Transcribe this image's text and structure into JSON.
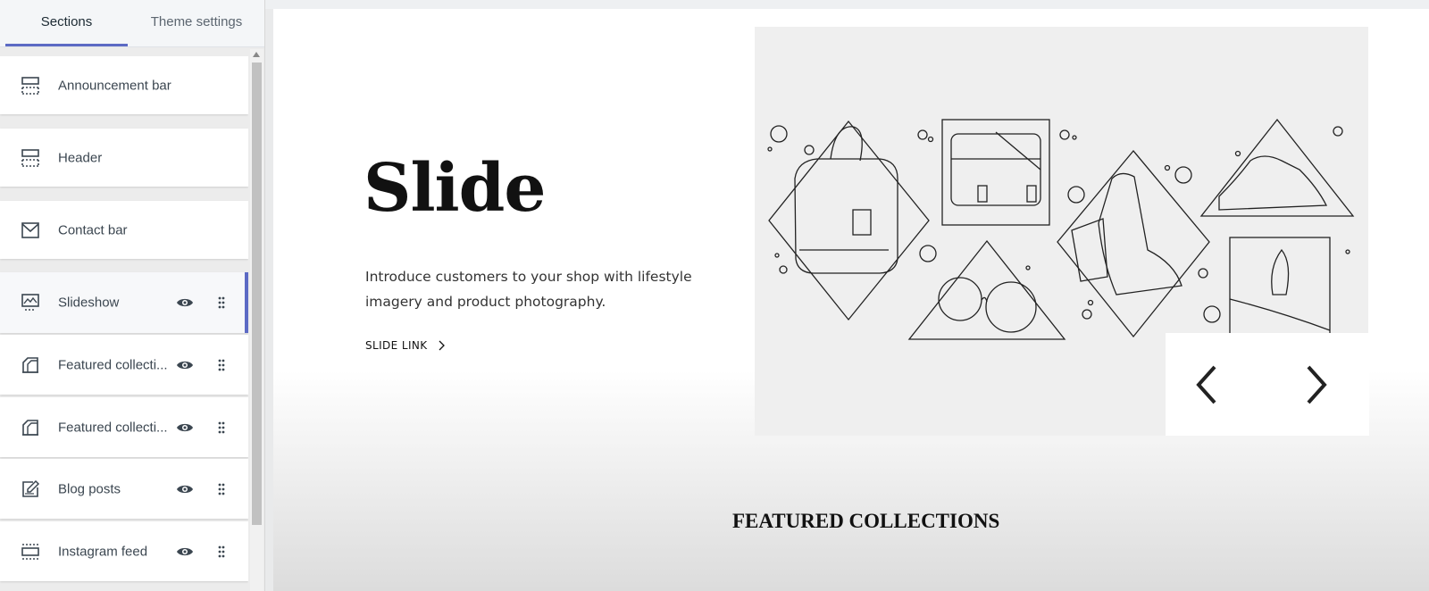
{
  "tabs": [
    {
      "label": "Sections",
      "active": true
    },
    {
      "label": "Theme settings",
      "active": false
    }
  ],
  "sections": [
    {
      "label": "Announcement bar",
      "icon": "layout-header-icon",
      "visibility_toggle": false
    },
    {
      "label": "Header",
      "icon": "layout-header-icon",
      "visibility_toggle": false
    },
    {
      "label": "Contact bar",
      "icon": "envelope-icon",
      "visibility_toggle": false
    },
    {
      "label": "Slideshow",
      "icon": "slideshow-icon",
      "visibility_toggle": true,
      "selected": true
    },
    {
      "label": "Featured collecti...",
      "icon": "collection-icon",
      "visibility_toggle": true
    },
    {
      "label": "Featured collecti...",
      "icon": "collection-icon",
      "visibility_toggle": true
    },
    {
      "label": "Blog posts",
      "icon": "blog-edit-icon",
      "visibility_toggle": true
    },
    {
      "label": "Instagram feed",
      "icon": "layout-block-icon",
      "visibility_toggle": true
    }
  ],
  "preview": {
    "slide_title": "Slide",
    "slide_text": "Introduce customers to your shop with lifestyle imagery and product photography.",
    "slide_link": "SLIDE LINK",
    "featured_heading": "FEATURED COLLECTIONS",
    "nav_icons": [
      "chevron-left-icon",
      "chevron-right-icon"
    ]
  },
  "colors": {
    "accent": "#5c6ac4",
    "sidebar_bg": "#ececec",
    "item_bg": "#ffffff",
    "text": "#3b4650",
    "art_bg": "#efefef"
  }
}
